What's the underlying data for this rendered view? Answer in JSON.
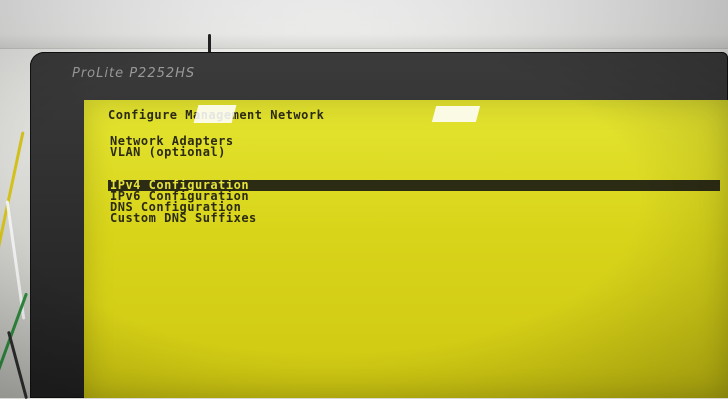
{
  "monitor": {
    "model_label": "ProLite P2252HS"
  },
  "screen": {
    "title": "Configure Management Network",
    "section_one": [
      {
        "label": "Network Adapters"
      },
      {
        "label": "VLAN (optional)"
      }
    ],
    "section_two": [
      {
        "label": "IPv4 Configuration",
        "selected": true
      },
      {
        "label": "IPv6 Configuration",
        "selected": false
      },
      {
        "label": "DNS Configuration",
        "selected": false
      },
      {
        "label": "Custom DNS Suffixes",
        "selected": false
      }
    ]
  },
  "colors": {
    "screen_background": "#d8d41a",
    "screen_text": "#2b2a12",
    "selection_background": "#2c2b14",
    "selection_text": "#e5e23a",
    "bezel": "#2a2a2a"
  }
}
